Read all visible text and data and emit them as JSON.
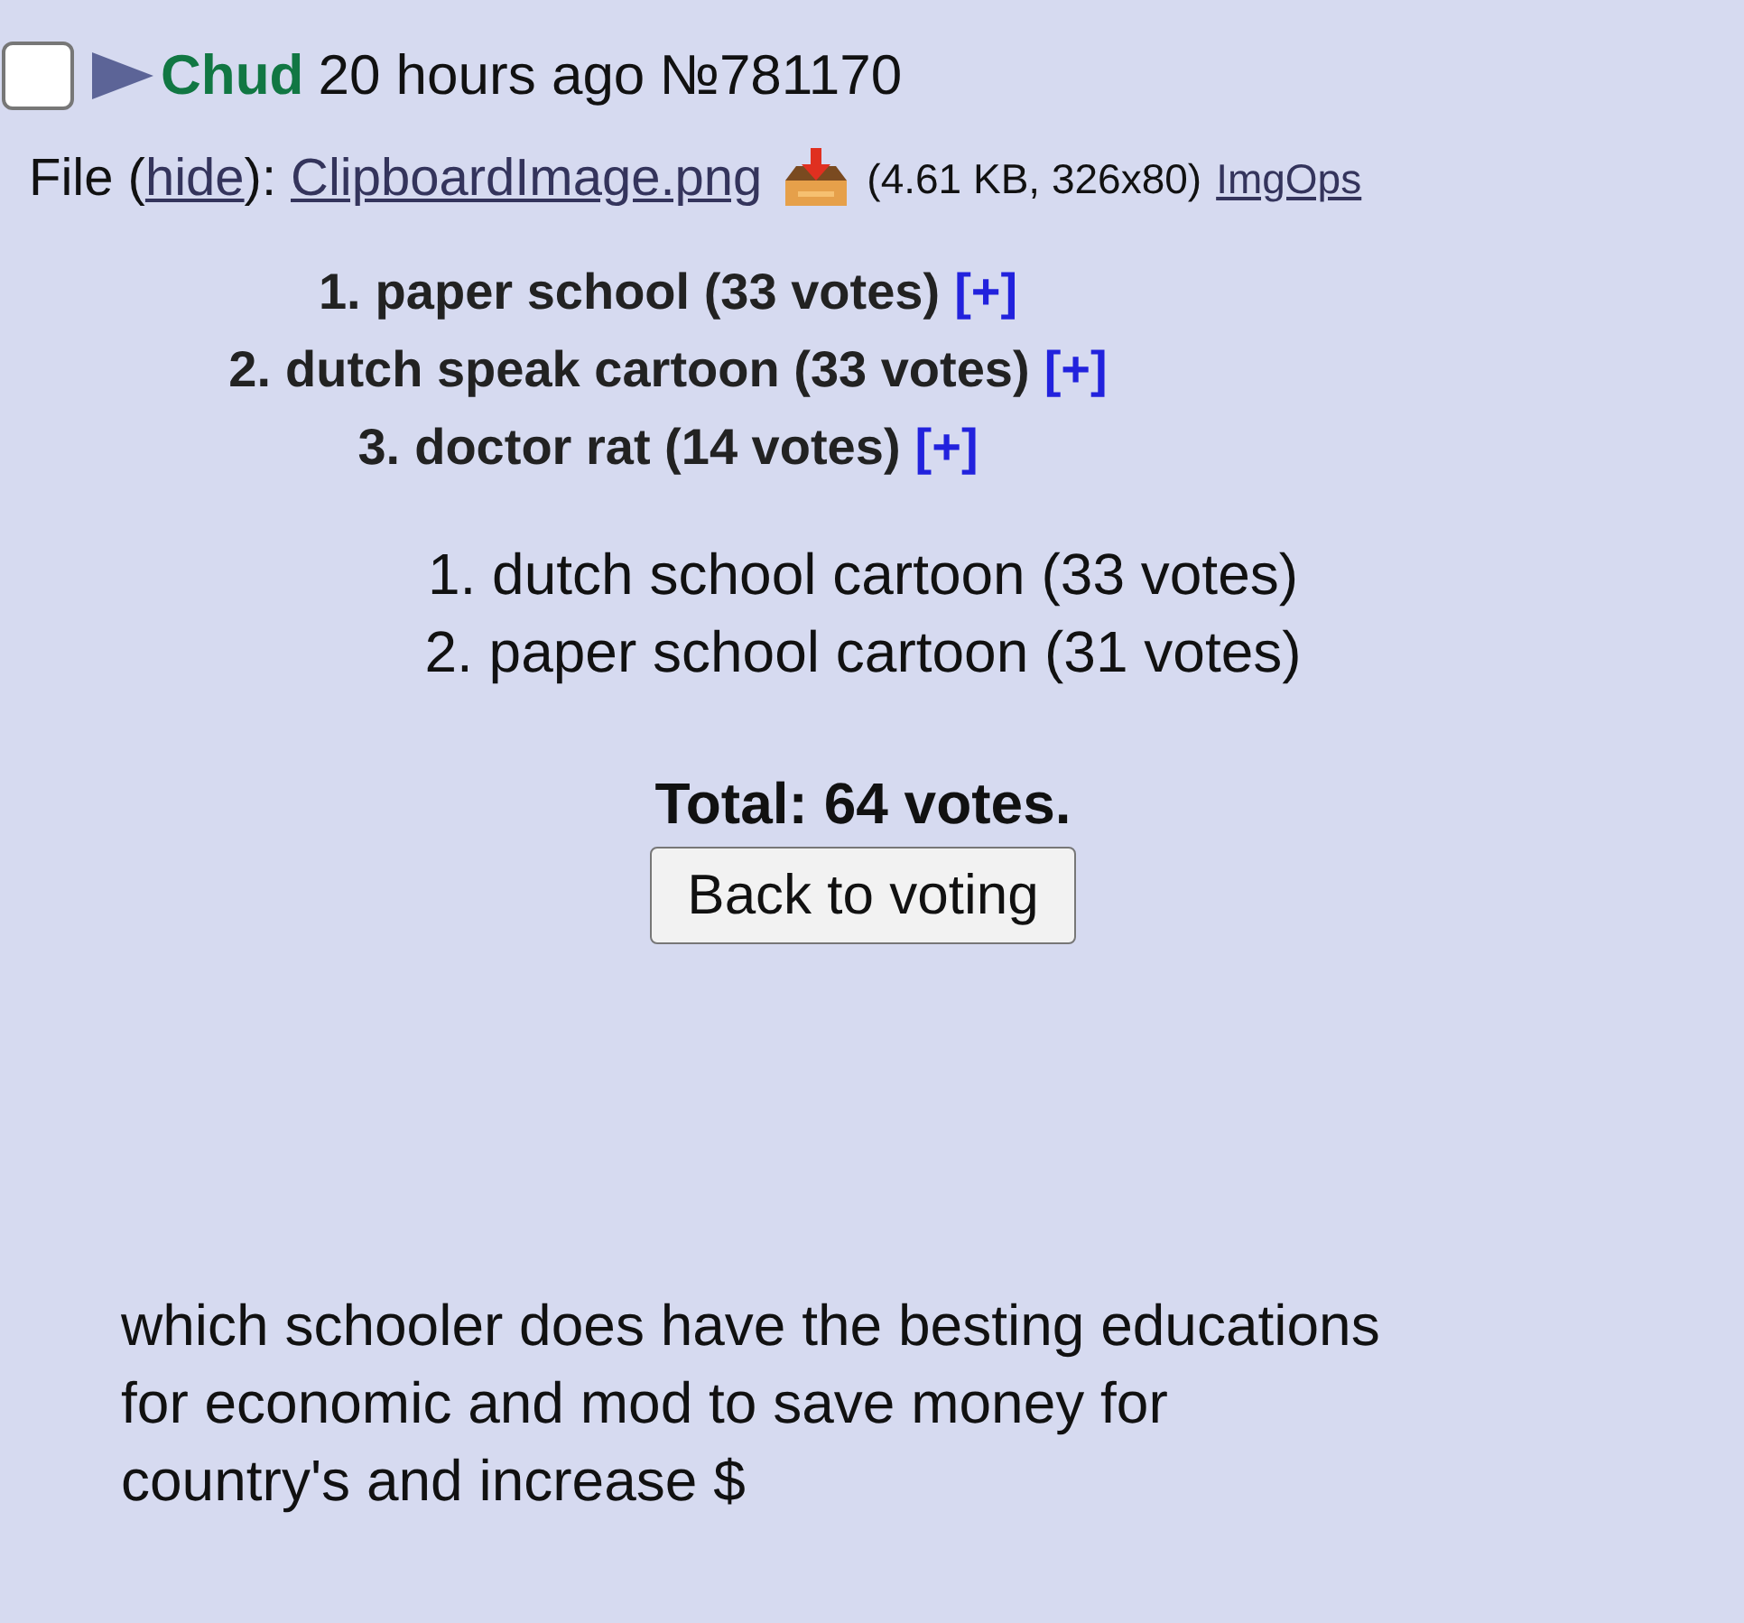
{
  "post": {
    "checked": false,
    "name": "Chud",
    "time": "20 hours ago",
    "number": "№781170"
  },
  "file": {
    "prefix": "File (",
    "hide": "hide",
    "suffix": "):",
    "filename": "ClipboardImage.png",
    "size": "(4.61 KB, 326x80)",
    "imgops": "ImgOps"
  },
  "image_list": [
    {
      "number": "1.",
      "text": "paper school (33 votes)",
      "mark": "[+]"
    },
    {
      "number": "2.",
      "text": "dutch speak cartoon (33 votes)",
      "mark": "[+]"
    },
    {
      "number": "3.",
      "text": "doctor rat (14 votes)",
      "mark": "[+]"
    }
  ],
  "results": [
    "1. dutch school cartoon (33 votes)",
    "2. paper school cartoon (31 votes)"
  ],
  "total": "Total: 64 votes.",
  "button": "Back to voting",
  "comment": [
    "which schooler does have the besting educations",
    "for economic and mod to save money for",
    "country's and increase $"
  ]
}
